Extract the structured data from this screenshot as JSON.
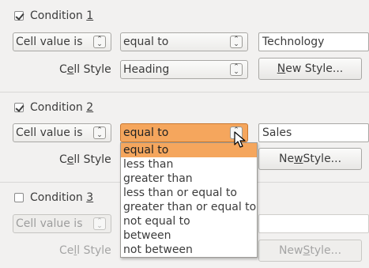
{
  "conditions": [
    {
      "label_prefix": "Condition ",
      "label_num": "1",
      "checked": true,
      "operand_type": "Cell value is",
      "operator": "equal to",
      "value": "Technology",
      "cell_style_label_pre": "C",
      "cell_style_label_u": "e",
      "cell_style_label_post": "ll Style",
      "cell_style_value": "Heading",
      "new_style_pre": "",
      "new_style_u": "N",
      "new_style_post": "ew Style..."
    },
    {
      "label_prefix": "Condition ",
      "label_num": "2",
      "checked": true,
      "operand_type": "Cell value is",
      "operator": "equal to",
      "value": "Sales",
      "cell_style_label_pre": "C",
      "cell_style_label_u": "e",
      "cell_style_label_post": "ll Style",
      "new_style_pre": "Ne",
      "new_style_u": "w",
      "new_style_post": " Style..."
    },
    {
      "label_prefix": "Condition ",
      "label_num": "3",
      "checked": false,
      "operand_type": "Cell value is",
      "cell_style_label_pre": "Ce",
      "cell_style_label_u": "l",
      "cell_style_label_post": "l Style",
      "new_style_pre": "New ",
      "new_style_u": "S",
      "new_style_post": "tyle..."
    }
  ],
  "operator_options": [
    "equal to",
    "less than",
    "greater than",
    "less than or equal to",
    "greater than or equal to",
    "not equal to",
    "between",
    "not between"
  ],
  "selected_option_index": 0,
  "colors": {
    "highlight": "#f5a65d",
    "background": "#f2f1f0"
  },
  "icons": {
    "spin": "up-down-chevron-icon",
    "check": "checkmark-icon",
    "cursor": "mouse-pointer-icon"
  }
}
